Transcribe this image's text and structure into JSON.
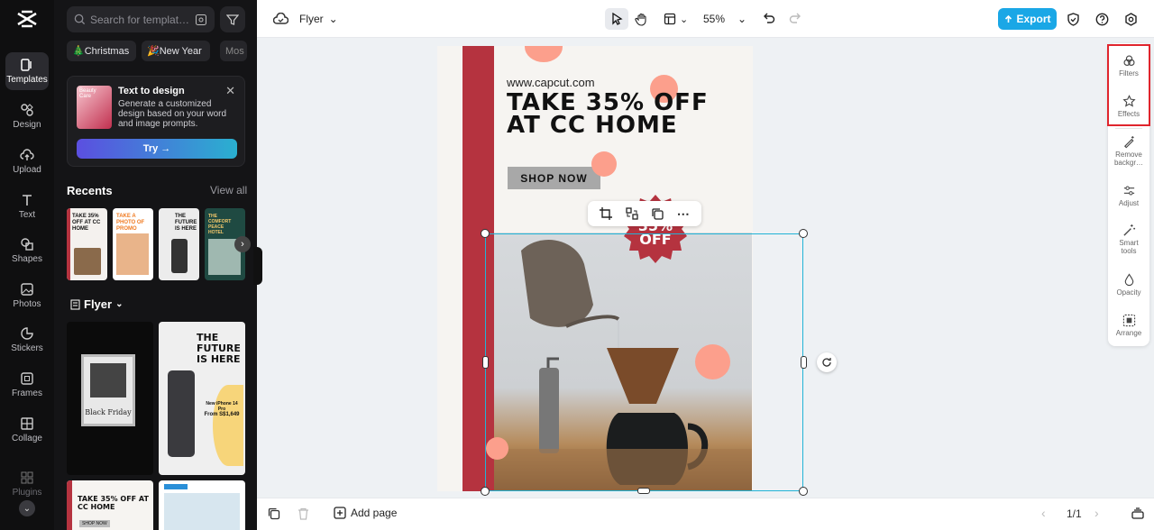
{
  "nav": {
    "items": [
      {
        "label": "Templates",
        "icon": "templates-icon"
      },
      {
        "label": "Design",
        "icon": "design-icon"
      },
      {
        "label": "Upload",
        "icon": "upload-icon"
      },
      {
        "label": "Text",
        "icon": "text-icon"
      },
      {
        "label": "Shapes",
        "icon": "shapes-icon"
      },
      {
        "label": "Photos",
        "icon": "photos-icon"
      },
      {
        "label": "Stickers",
        "icon": "stickers-icon"
      },
      {
        "label": "Frames",
        "icon": "frames-icon"
      },
      {
        "label": "Collage",
        "icon": "collage-icon"
      },
      {
        "label": "Plugins",
        "icon": "plugins-icon"
      }
    ]
  },
  "panel": {
    "search_placeholder": "Search for templat…",
    "chips": [
      "🎄Christmas",
      "🎉New Year",
      "Mos"
    ],
    "ttd": {
      "title": "Text to design",
      "desc": "Generate a customized design based on your word and image prompts.",
      "try_label": "Try →",
      "thumb_label": "Beauty Care"
    },
    "recents_title": "Recents",
    "view_all": "View all",
    "recents": [
      "TAKE 35% OFF AT CC HOME",
      "TAKE A PHOTO OF PROMO",
      "THE FUTURE IS HERE",
      "THE COMFORT PEACE HOTEL"
    ],
    "flyer_title": "Flyer",
    "templates": [
      {
        "title": "Black Friday"
      },
      {
        "title": "THE FUTURE IS HERE",
        "sub": "New iPhone 14 Pro",
        "price": "From S$1,649"
      },
      {
        "title": "TAKE 35% OFF AT CC HOME",
        "sub": "SHOP NOW"
      },
      {
        "title": ""
      }
    ]
  },
  "topbar": {
    "doc_name": "Flyer",
    "zoom": "55%",
    "export_label": "Export"
  },
  "canvas": {
    "url": "www.capcut.com",
    "headline_1": "TAKE 35% OFF",
    "headline_2": "AT CC HOME",
    "shop_now": "SHOP NOW",
    "burst_1": "35%",
    "burst_2": "OFF"
  },
  "rpanel": {
    "items": [
      {
        "label": "Filters"
      },
      {
        "label": "Effects"
      },
      {
        "label": "Remove backgr…"
      },
      {
        "label": "Adjust"
      },
      {
        "label": "Smart tools"
      },
      {
        "label": "Opacity"
      },
      {
        "label": "Arrange"
      }
    ]
  },
  "bottombar": {
    "add_page": "Add page",
    "page_count": "1/1"
  },
  "colors": {
    "accent": "#1aa7e6",
    "selection": "#21b3d6",
    "flyer_red": "#b5333f",
    "peach": "#fc9f8c",
    "highlight": "#e0252d"
  }
}
